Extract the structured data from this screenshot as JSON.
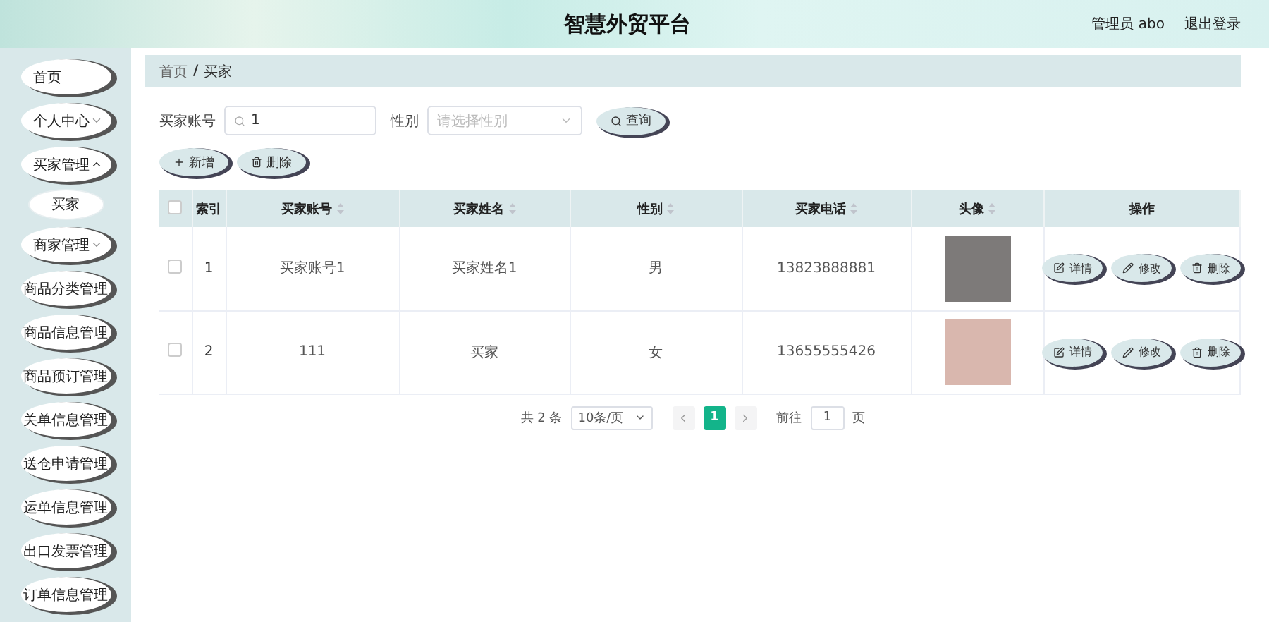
{
  "header": {
    "title": "智慧外贸平台",
    "user": "管理员 abo",
    "logout": "退出登录"
  },
  "sidebar": {
    "items": [
      {
        "label": "首页"
      },
      {
        "label": "个人中心",
        "expanded": false
      },
      {
        "label": "买家管理",
        "expanded": true,
        "children": [
          {
            "label": "买家",
            "selected": true
          }
        ]
      },
      {
        "label": "商家管理",
        "expanded": false
      },
      {
        "label": "商品分类管理"
      },
      {
        "label": "商品信息管理"
      },
      {
        "label": "商品预订管理"
      },
      {
        "label": "关单信息管理"
      },
      {
        "label": "送仓申请管理"
      },
      {
        "label": "运单信息管理"
      },
      {
        "label": "出口发票管理"
      },
      {
        "label": "订单信息管理"
      }
    ]
  },
  "breadcrumb": [
    "首页",
    "买家"
  ],
  "breadcrumb_separator": "/",
  "search": {
    "account_label": "买家账号",
    "account_value": "1",
    "gender_label": "性别",
    "gender_placeholder": "请选择性别",
    "query_button": "查询"
  },
  "actions": [
    "新增",
    "删除"
  ],
  "table": {
    "select_all_checked": false,
    "columns": [
      {
        "label": "索引",
        "sortable": false
      },
      {
        "label": "买家账号",
        "sortable": true
      },
      {
        "label": "买家姓名",
        "sortable": true
      },
      {
        "label": "性别",
        "sortable": true
      },
      {
        "label": "买家电话",
        "sortable": true
      },
      {
        "label": "头像",
        "sortable": true
      },
      {
        "label": "操作",
        "sortable": false
      }
    ],
    "rows": [
      {
        "checked": false,
        "index": "1",
        "account": "买家账号1",
        "name": "买家姓名1",
        "gender": "男",
        "phone": "13823888881",
        "buttons": [
          {
            "kind": "detail",
            "label": "详情"
          },
          {
            "kind": "edit",
            "label": "修改"
          },
          {
            "kind": "delete",
            "label": "删除"
          }
        ]
      },
      {
        "checked": false,
        "index": "2",
        "account": "111",
        "name": "买家",
        "gender": "女",
        "phone": "13655555426",
        "buttons": [
          {
            "kind": "detail",
            "label": "详情"
          },
          {
            "kind": "edit",
            "label": "修改"
          },
          {
            "kind": "delete",
            "label": "删除"
          }
        ]
      }
    ]
  },
  "pagination": {
    "total": "共 2 条",
    "page_size": "10条/页",
    "pages": [
      {
        "label": "1",
        "selected": true
      }
    ],
    "goto_label": "前往",
    "goto_value": "1",
    "goto_suffix": "页"
  }
}
